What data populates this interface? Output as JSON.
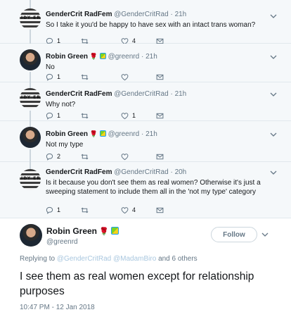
{
  "thread": [
    {
      "name": "GenderCrit RadFem",
      "handle": "@GenderCritRad",
      "sep": "·",
      "time": "21h",
      "text": "So I take it you'd be happy to have sex with an intact trans woman?",
      "counts": {
        "replies": "1",
        "retweets": "",
        "likes": "4"
      },
      "avatar": "flag-avatar",
      "avatar_text": "IDY  ER",
      "badges": false
    },
    {
      "name": "Robin Green",
      "handle": "@greenrd",
      "sep": "·",
      "time": "21h",
      "text": "No",
      "counts": {
        "replies": "1",
        "retweets": "",
        "likes": ""
      },
      "avatar": "person-avatar",
      "badges": true
    },
    {
      "name": "GenderCrit RadFem",
      "handle": "@GenderCritRad",
      "sep": "·",
      "time": "21h",
      "text": "Why not?",
      "counts": {
        "replies": "1",
        "retweets": "",
        "likes": "1"
      },
      "avatar": "flag-avatar",
      "avatar_text": "IDY  ER",
      "badges": false
    },
    {
      "name": "Robin Green",
      "handle": "@greenrd",
      "sep": "·",
      "time": "21h",
      "text": "Not my type",
      "counts": {
        "replies": "2",
        "retweets": "",
        "likes": ""
      },
      "avatar": "person-avatar",
      "badges": true
    },
    {
      "name": "GenderCrit RadFem",
      "handle": "@GenderCritRad",
      "sep": "·",
      "time": "20h",
      "text": "Is it because you don't see them as real women? Otherwise it's just a sweeping statement to include them all in the 'not my type' category",
      "counts": {
        "replies": "1",
        "retweets": "",
        "likes": "4"
      },
      "avatar": "flag-avatar",
      "avatar_text": "IDY  ER",
      "badges": false
    }
  ],
  "main": {
    "name": "Robin Green",
    "handle": "@greenrd",
    "follow_label": "Follow",
    "replying_prefix": "Replying to",
    "replying_to_1": "@GenderCritRad",
    "replying_to_2": "@MadamBiro",
    "replying_suffix": "and 6 others",
    "text": "I see them as real women except for relationship purposes",
    "timestamp": "10:47 PM - 12 Jan 2018"
  },
  "icons": {
    "reply": "reply-icon",
    "retweet": "retweet-icon",
    "like": "heart-icon",
    "dm": "envelope-icon",
    "caret": "chevron-down-icon",
    "rose": "rose-icon",
    "leaf": "beginner-leaf-icon"
  },
  "colors": {
    "thread_bg": "#f5f8fa",
    "text": "#14171a",
    "muted": "#657786",
    "link": "#a9c7df",
    "border": "#e1e8ed"
  }
}
